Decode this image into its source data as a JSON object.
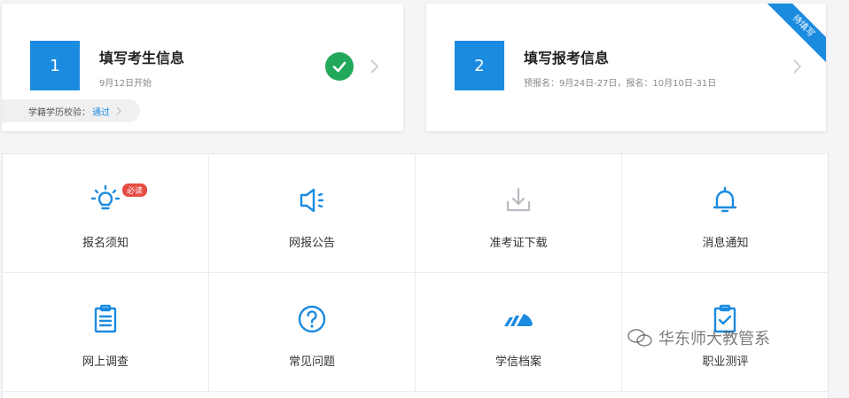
{
  "steps": [
    {
      "number": "1",
      "title": "填写考生信息",
      "subtitle": "9月12日开始",
      "status_icon": "check-circle-icon",
      "verify_label": "学籍学历校验：",
      "verify_status": "通过"
    },
    {
      "number": "2",
      "title": "填写报考信息",
      "subtitle": "预报名：9月24日-27日，报名：10月10日-31日",
      "ribbon": "待填写"
    }
  ],
  "grid": [
    {
      "label": "报名须知",
      "icon": "lightbulb-icon",
      "badge": "必读"
    },
    {
      "label": "网报公告",
      "icon": "megaphone-icon"
    },
    {
      "label": "准考证下载",
      "icon": "download-icon"
    },
    {
      "label": "消息通知",
      "icon": "bell-icon"
    },
    {
      "label": "网上调查",
      "icon": "clipboard-icon"
    },
    {
      "label": "常见问题",
      "icon": "question-icon"
    },
    {
      "label": "学信档案",
      "icon": "chsi-logo-icon"
    },
    {
      "label": "职业测评",
      "icon": "checklist-icon"
    }
  ],
  "watermark": "华东师大教管系",
  "colors": {
    "accent": "#1b8be0",
    "success": "#22a85a",
    "badge": "#e54d42"
  }
}
